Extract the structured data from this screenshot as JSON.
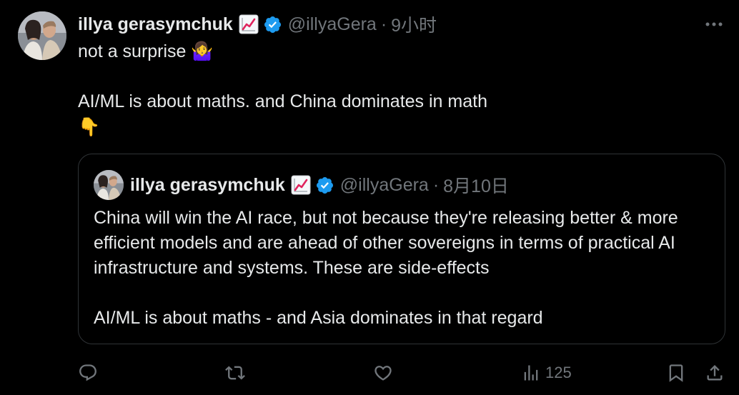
{
  "tweet": {
    "author": {
      "name": "illya gerasymchuk",
      "handle": "@illyaGera",
      "avatar": "profile-photo",
      "badge_emoji": "chart-increasing-icon",
      "verified_icon": "verified-badge-icon"
    },
    "separator": "·",
    "time": "9小时",
    "text_line1": "not a surprise",
    "text_emoji1": "🤷‍♀️",
    "text_line2": "AI/ML is about maths. and China dominates in math",
    "text_emoji2": "👇"
  },
  "quote": {
    "author": {
      "name": "illya gerasymchuk",
      "handle": "@illyaGera",
      "avatar": "profile-photo",
      "badge_emoji": "chart-increasing-icon",
      "verified_icon": "verified-badge-icon"
    },
    "separator": "·",
    "time": "8月10日",
    "text_para1": "China will win the AI race, but not because they're releasing better & more efficient models and are ahead of other sovereigns in terms of practical AI infrastructure and systems. These are side-effects",
    "text_para2": "AI/ML is about maths - and Asia dominates in that regard"
  },
  "actions": {
    "reply_icon": "reply-icon",
    "retweet_icon": "retweet-icon",
    "like_icon": "heart-icon",
    "views_icon": "views-chart-icon",
    "views_count": "125",
    "bookmark_icon": "bookmark-icon",
    "share_icon": "share-icon"
  },
  "colors": {
    "background": "#000000",
    "text_primary": "#e7e9ea",
    "text_secondary": "#71767b",
    "border": "#2f3336",
    "verified": "#1d9bf0"
  }
}
